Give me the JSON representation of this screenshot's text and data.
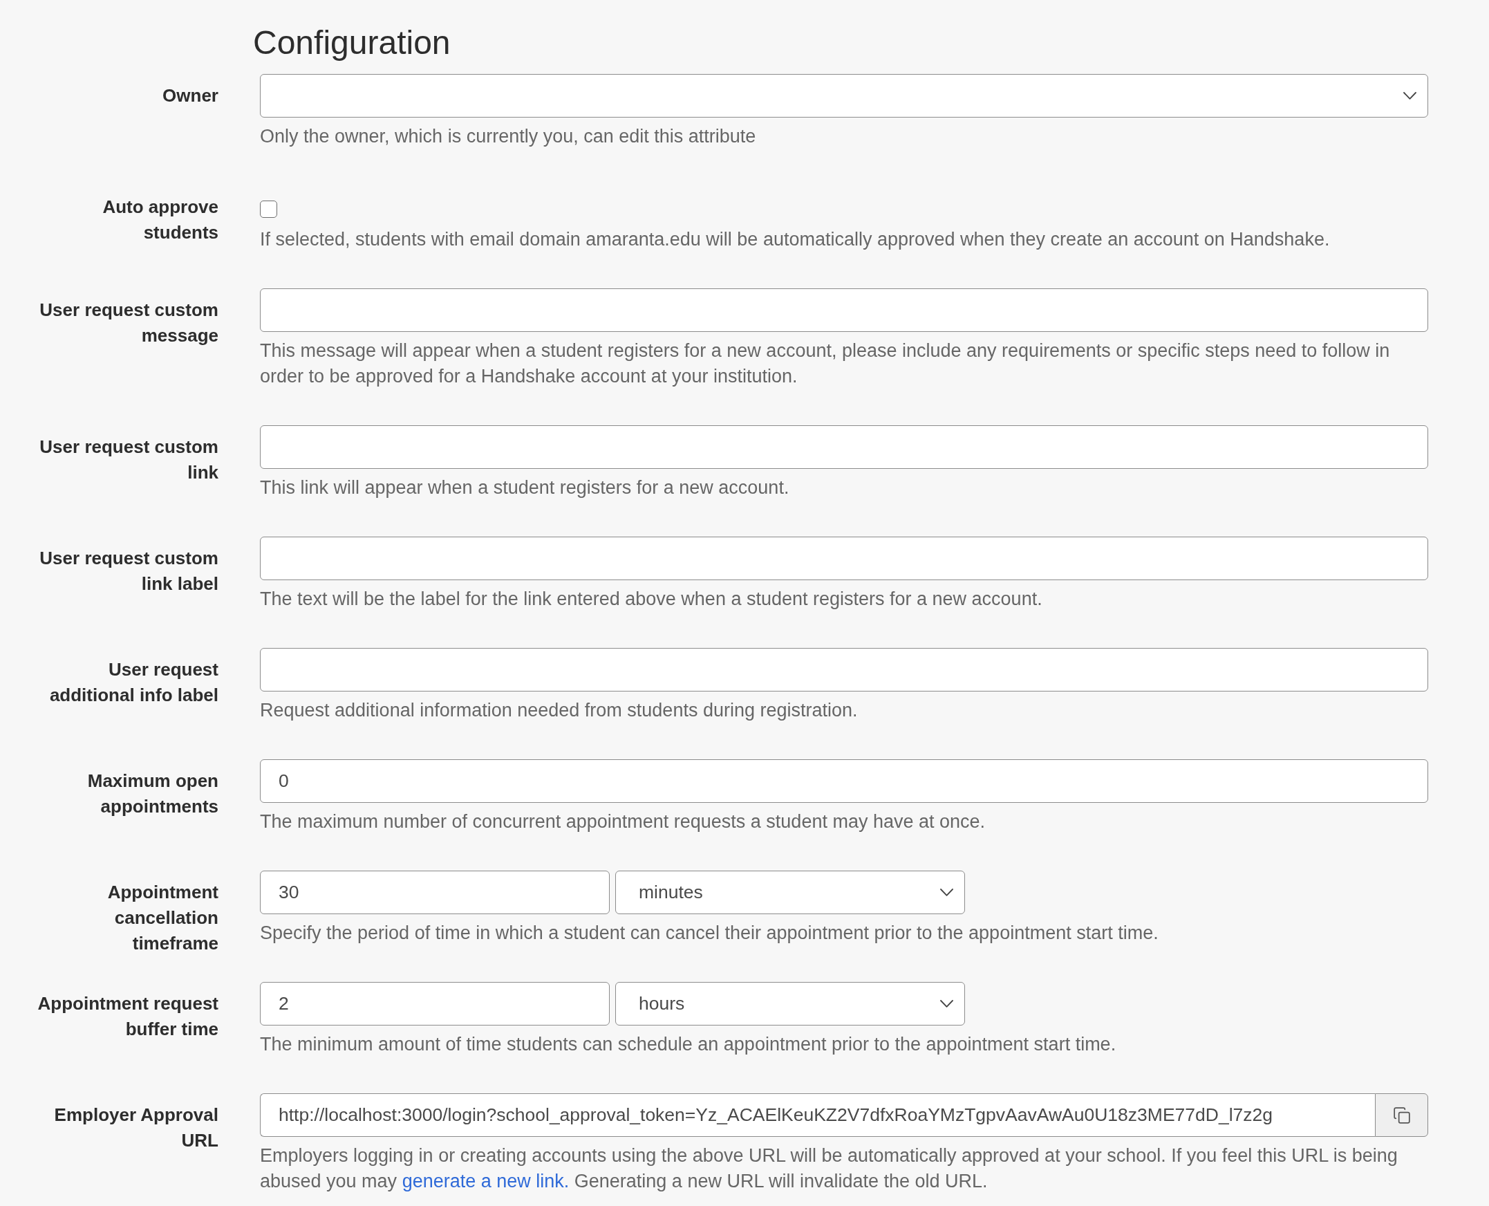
{
  "title": "Configuration",
  "fields": [
    {
      "kind": "select",
      "label": "Owner",
      "help": "Only the owner, which is currently you, can edit this attribute"
    },
    {
      "kind": "checkbox",
      "label": "Auto approve students",
      "checked": false,
      "help": "If selected, students with email domain amaranta.edu will be automatically approved when they create an account on Handshake."
    },
    {
      "kind": "text",
      "label": "User request custom message",
      "help": "This message will appear when a student registers for a new account, please include any requirements or specific steps need to follow in order to be approved for a Handshake account at your institution."
    },
    {
      "kind": "text",
      "label": "User request custom link",
      "help": "This link will appear when a student registers for a new account."
    },
    {
      "kind": "text",
      "label": "User request custom link label",
      "help": "The text will be the label for the link entered above when a student registers for a new account."
    },
    {
      "kind": "text",
      "label": "User request additional info label",
      "help": "Request additional information needed from students during registration."
    },
    {
      "kind": "text",
      "label": "Maximum open appointments",
      "value": "0",
      "help": "The maximum number of concurrent appointment requests a student may have at once."
    },
    {
      "kind": "amount",
      "label": "Appointment cancellation timeframe",
      "value": "30",
      "unit": "minutes",
      "help": "Specify the period of time in which a student can cancel their appointment prior to the appointment start time."
    },
    {
      "kind": "amount",
      "label": "Appointment request buffer time",
      "value": "2",
      "unit": "hours",
      "help": "The minimum amount of time students can schedule an appointment prior to the appointment start time."
    },
    {
      "kind": "copy",
      "label": "Employer Approval URL",
      "value": "http://localhost:3000/login?school_approval_token=Yz_ACAElKeuKZ2V7dfxRoaYMzTgpvAavAwAu0U18z3ME77dD_l7z2g",
      "help_parts": [
        {
          "kind": "text",
          "text": "Employers logging in or creating accounts using the above URL will be automatically approved at your school. If you feel this URL is being abused you may "
        },
        {
          "kind": "link",
          "text": "generate a new link."
        },
        {
          "kind": "text",
          "text": " Generating a new URL will invalidate the old URL."
        }
      ]
    }
  ]
}
